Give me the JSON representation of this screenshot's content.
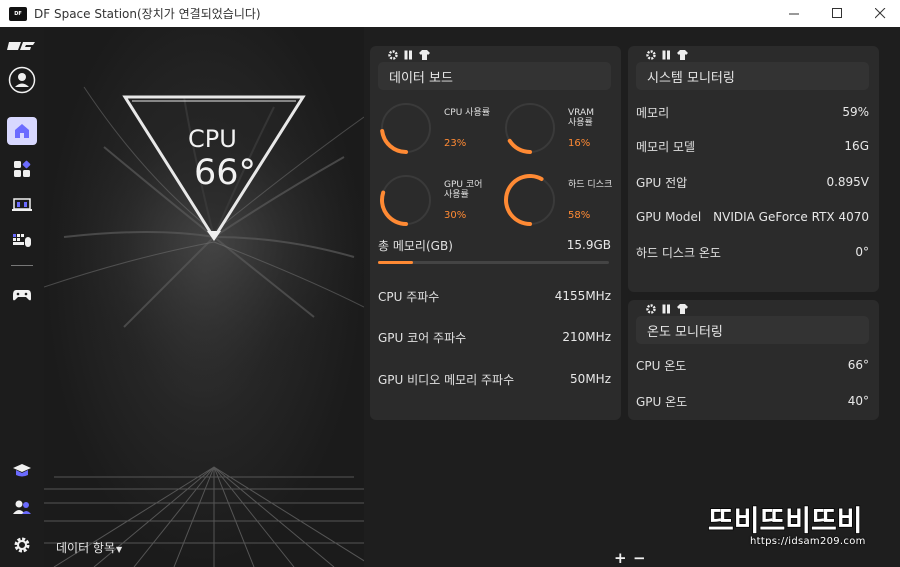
{
  "window": {
    "title": "DF Space Station(장치가 연결되었습니다)",
    "logo_text": "DF"
  },
  "hero": {
    "cpu_label": "CPU",
    "cpu_temp": "66°",
    "data_items_label": "데이터 항목",
    "zoom_in": "+",
    "zoom_out": "−"
  },
  "data_board": {
    "title": "데이터 보드",
    "gauges": [
      {
        "label_lines": [
          "CPU 사용률"
        ],
        "value": "23%",
        "percent": 23
      },
      {
        "label_lines": [
          "VRAM",
          "사용률"
        ],
        "value": "16%",
        "percent": 16
      },
      {
        "label_lines": [
          "GPU 코어",
          "사용률"
        ],
        "value": "30%",
        "percent": 30
      },
      {
        "label_lines": [
          "하드 디스크"
        ],
        "value": "58%",
        "percent": 58
      }
    ],
    "total_memory_label": "총 메모리(GB)",
    "total_memory_value": "15.9GB",
    "total_memory_fraction": 0.15,
    "rows": [
      {
        "label": "CPU 주파수",
        "value": "4155MHz"
      },
      {
        "label": "GPU 코어 주파수",
        "value": "210MHz"
      },
      {
        "label": "GPU 비디오 메모리 주파수",
        "value": "50MHz"
      }
    ]
  },
  "system_monitor": {
    "title": "시스템 모니터링",
    "rows": [
      {
        "label": "메모리",
        "value": "59%"
      },
      {
        "label": "메모리 모델",
        "value": "16G"
      },
      {
        "label": "GPU 전압",
        "value": "0.895V"
      },
      {
        "label": "GPU Model",
        "value": "NVIDIA GeForce RTX 4070"
      },
      {
        "label": "하드 디스크 온도",
        "value": "0°"
      }
    ]
  },
  "temp_monitor": {
    "title": "온도 모니터링",
    "rows": [
      {
        "label": "CPU 온도",
        "value": "66°"
      },
      {
        "label": "GPU 온도",
        "value": "40°"
      }
    ]
  },
  "watermark": {
    "text": "뜨비뜨비뜨비",
    "url": "https://idsam209.com"
  },
  "colors": {
    "accent": "#ff8a34",
    "panel": "#2b2b2b",
    "background": "#1e1e1e",
    "home_highlight": "#d8d8ff"
  },
  "icons": {
    "sidebar": [
      "df-logo-icon",
      "user-avatar-icon",
      "home-icon",
      "apps-icon",
      "monitor-icon",
      "keyboard-mouse-icon",
      "gamepad-icon",
      "graduation-cap-icon",
      "users-icon",
      "gear-icon"
    ],
    "panel_toolbar": [
      "gear-icon",
      "memory-icon",
      "shirt-icon"
    ]
  }
}
